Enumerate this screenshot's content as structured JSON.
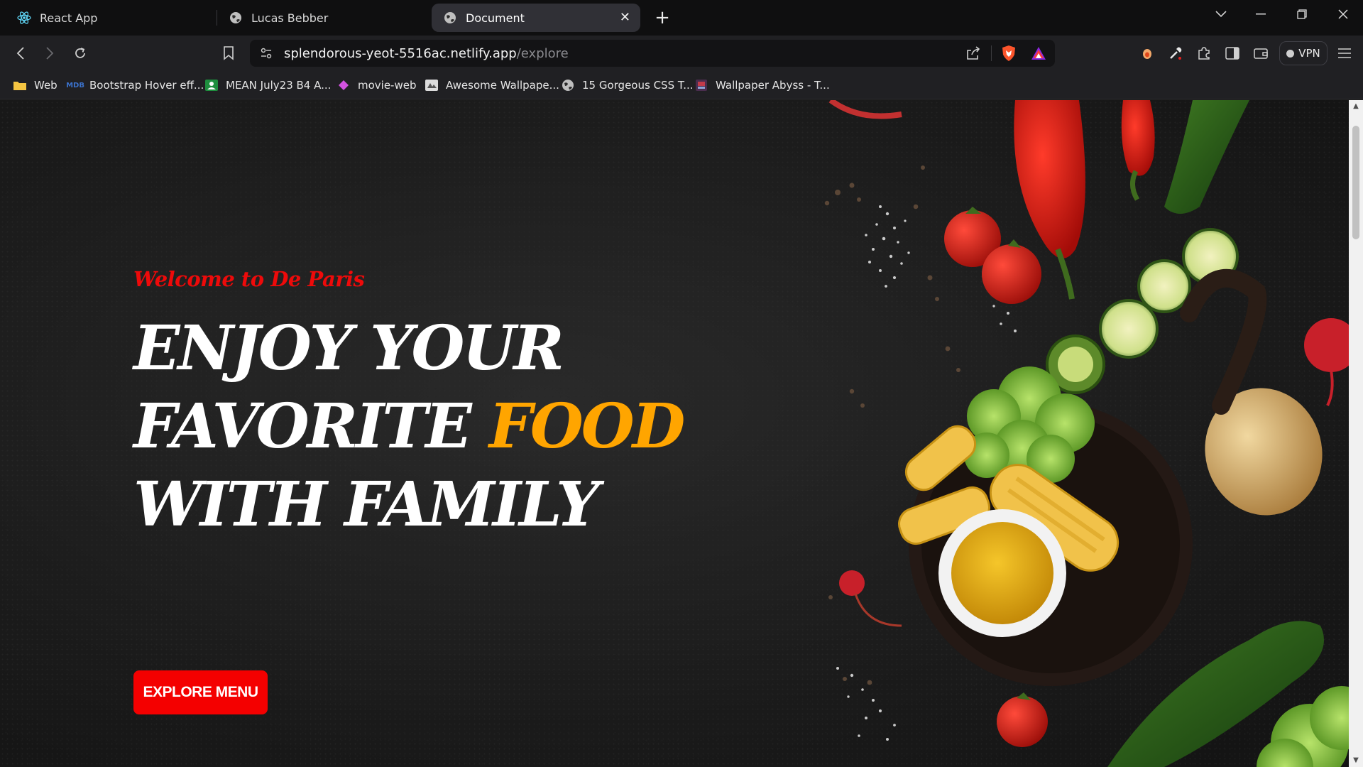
{
  "tabs": [
    {
      "title": "React App",
      "icon": "react-icon"
    },
    {
      "title": "Lucas Bebber",
      "icon": "globe-icon"
    },
    {
      "title": "Document",
      "icon": "globe-icon",
      "active": true
    }
  ],
  "address_bar": {
    "host": "splendorous-yeot-5516ac.netlify.app",
    "path": "/explore"
  },
  "vpn_label": "VPN",
  "bookmarks": [
    {
      "label": "Web",
      "icon": "folder-icon"
    },
    {
      "label": "Bootstrap Hover eff...",
      "icon": "mdb-icon"
    },
    {
      "label": "MEAN July23 B4 A...",
      "icon": "classroom-icon"
    },
    {
      "label": "movie-web",
      "icon": "diamond-icon"
    },
    {
      "label": "Awesome Wallpape...",
      "icon": "wallpaper-icon"
    },
    {
      "label": "15 Gorgeous CSS T...",
      "icon": "globe-icon"
    },
    {
      "label": "Wallpaper Abyss - T...",
      "icon": "abyss-icon"
    }
  ],
  "hero": {
    "welcome": "Welcome to De Paris",
    "line1": "ENJOY YOUR",
    "line2_a": "FAVORITE ",
    "line2_accent": "FOOD",
    "line3": "WITH FAMILY",
    "cta_label": "EXPLORE MENU"
  },
  "colors": {
    "accent_red": "#f40000",
    "accent_orange": "#ffa500",
    "background": "#1c1c1c"
  }
}
